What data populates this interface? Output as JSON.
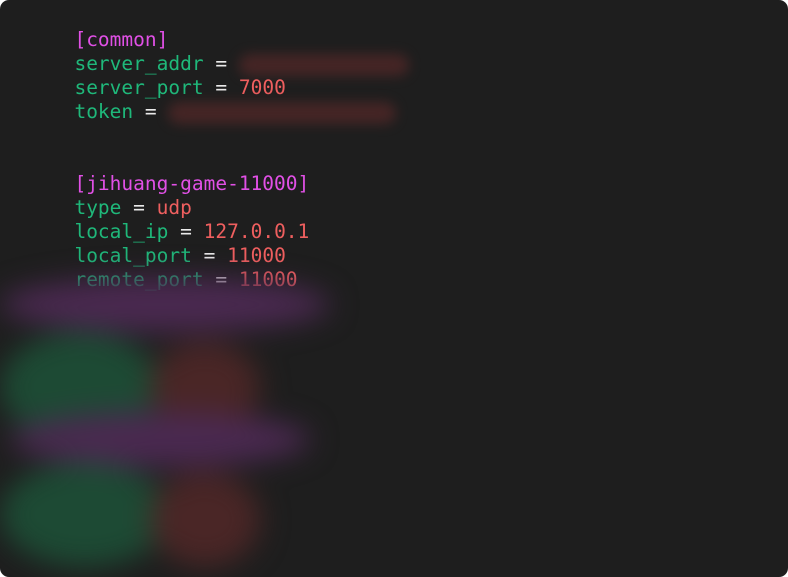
{
  "config": {
    "common_header": "[common]",
    "server_addr_key": "server_addr",
    "server_port_key": "server_port",
    "server_port_value": "7000",
    "token_key": "token",
    "proxy_header": "[jihuang-game-11000]",
    "type_key": "type",
    "type_value": "udp",
    "local_ip_key": "local_ip",
    "local_ip_value": "127.0.0.1",
    "local_port_key": "local_port",
    "local_port_value": "11000",
    "remote_port_key": "remote_port",
    "remote_port_value": "11000",
    "equals": "="
  },
  "colors": {
    "background": "#1e1e1e",
    "section": "#e150e6",
    "key": "#1fb87a",
    "value": "#ef5f5f",
    "operator": "#eaeaea"
  }
}
